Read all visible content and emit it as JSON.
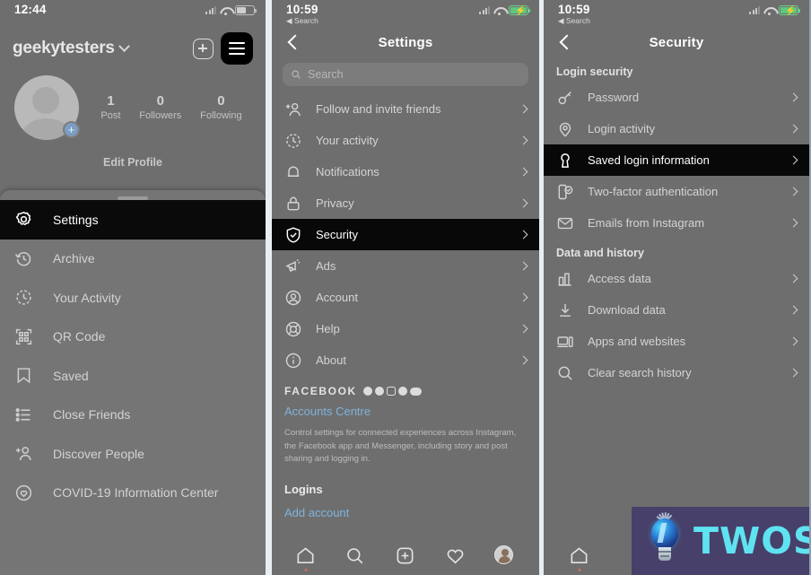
{
  "panel1": {
    "status": {
      "time": "12:44",
      "battery_charging": false
    },
    "profile": {
      "username": "geekytesters",
      "stats": [
        {
          "num": "1",
          "label": "Post"
        },
        {
          "num": "0",
          "label": "Followers"
        },
        {
          "num": "0",
          "label": "Following"
        }
      ],
      "edit_profile": "Edit Profile"
    },
    "menu": [
      {
        "label": "Settings",
        "icon": "gear-icon",
        "active": true
      },
      {
        "label": "Archive",
        "icon": "archive-clock-icon",
        "active": false
      },
      {
        "label": "Your Activity",
        "icon": "activity-clock-icon",
        "active": false
      },
      {
        "label": "QR Code",
        "icon": "qr-code-icon",
        "active": false
      },
      {
        "label": "Saved",
        "icon": "bookmark-icon",
        "active": false
      },
      {
        "label": "Close Friends",
        "icon": "close-friends-list-icon",
        "active": false
      },
      {
        "label": "Discover People",
        "icon": "add-person-icon",
        "active": false
      },
      {
        "label": "COVID-19 Information Center",
        "icon": "covid-heart-icon",
        "active": false
      }
    ]
  },
  "panel2": {
    "status": {
      "time": "10:59",
      "back_label": "◀ Search",
      "battery_charging": true
    },
    "nav": {
      "title": "Settings"
    },
    "search": {
      "placeholder": "Search",
      "value": ""
    },
    "items": [
      {
        "label": "Follow and invite friends",
        "icon": "add-person-icon",
        "active": false
      },
      {
        "label": "Your activity",
        "icon": "activity-clock-icon",
        "active": false
      },
      {
        "label": "Notifications",
        "icon": "bell-icon",
        "active": false
      },
      {
        "label": "Privacy",
        "icon": "lock-icon",
        "active": false
      },
      {
        "label": "Security",
        "icon": "shield-check-icon",
        "active": true
      },
      {
        "label": "Ads",
        "icon": "megaphone-icon",
        "active": false
      },
      {
        "label": "Account",
        "icon": "account-circle-icon",
        "active": false
      },
      {
        "label": "Help",
        "icon": "lifebuoy-icon",
        "active": false
      },
      {
        "label": "About",
        "icon": "info-circle-icon",
        "active": false
      }
    ],
    "facebook": {
      "title": "FACEBOOK",
      "icons": [
        "facebook-icon",
        "messenger-icon",
        "instagram-icon",
        "whatsapp-icon",
        "oval-icon"
      ],
      "link": "Accounts Centre",
      "description": "Control settings for connected experiences across Instagram, the Facebook app and Messenger, including story and post sharing and logging in."
    },
    "logins": {
      "heading": "Logins",
      "add_account": "Add account"
    },
    "tabs": [
      "home-icon",
      "search-icon",
      "add-post-icon",
      "heart-icon",
      "profile-avatar"
    ]
  },
  "panel3": {
    "status": {
      "time": "10:59",
      "back_label": "◀ Search",
      "battery_charging": true
    },
    "nav": {
      "title": "Security"
    },
    "sections": [
      {
        "heading": "Login security",
        "items": [
          {
            "label": "Password",
            "icon": "key-icon",
            "active": false
          },
          {
            "label": "Login activity",
            "icon": "location-pin-icon",
            "active": false
          },
          {
            "label": "Saved login information",
            "icon": "keyhole-icon",
            "active": true
          },
          {
            "label": "Two-factor authentication",
            "icon": "phone-check-icon",
            "active": false
          },
          {
            "label": "Emails from Instagram",
            "icon": "envelope-icon",
            "active": false
          }
        ]
      },
      {
        "heading": "Data and history",
        "items": [
          {
            "label": "Access data",
            "icon": "bar-chart-icon",
            "active": false
          },
          {
            "label": "Download data",
            "icon": "download-icon",
            "active": false
          },
          {
            "label": "Apps and websites",
            "icon": "apps-websites-icon",
            "active": false
          },
          {
            "label": "Clear search history",
            "icon": "search-icon",
            "active": false
          }
        ]
      }
    ],
    "tabs": [
      "home-icon",
      "search-icon"
    ]
  },
  "watermark": {
    "text": "TWOS",
    "bg": "#46406b",
    "accent": "#5fe3f0"
  }
}
